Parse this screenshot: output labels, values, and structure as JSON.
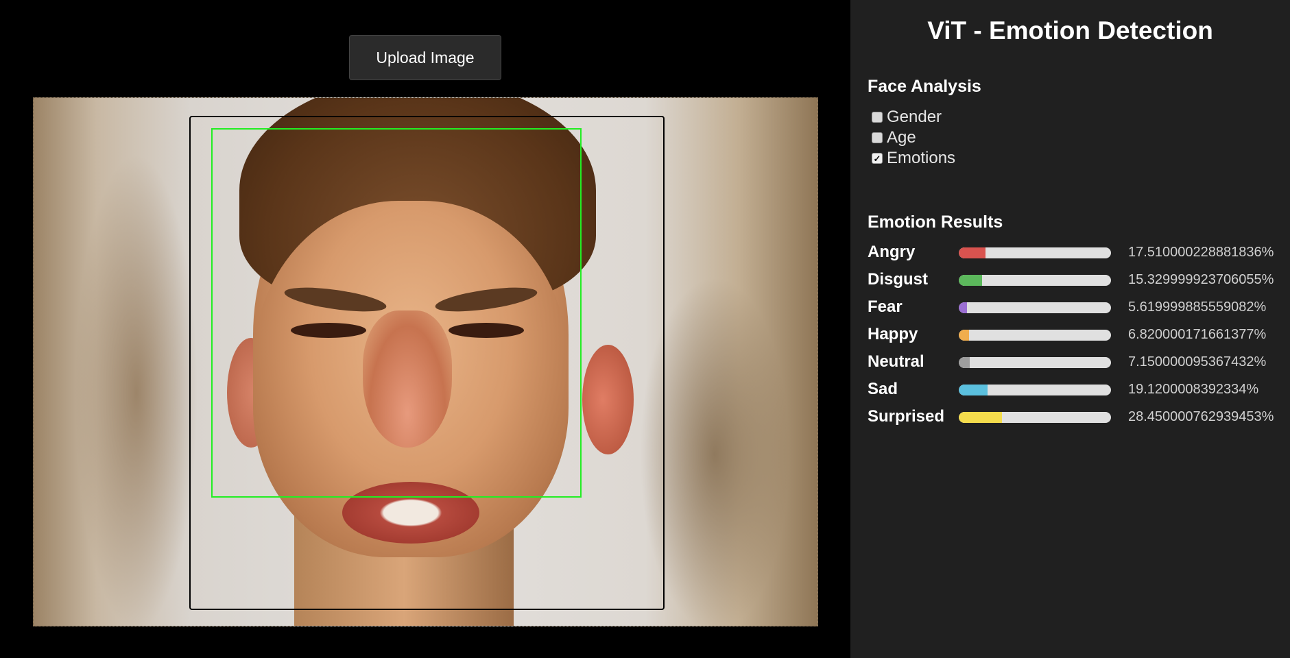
{
  "upload": {
    "label": "Upload Image"
  },
  "panel": {
    "title": "ViT - Emotion Detection",
    "face_analysis": {
      "heading": "Face Analysis",
      "options": [
        {
          "label": "Gender",
          "checked": false
        },
        {
          "label": "Age",
          "checked": false
        },
        {
          "label": "Emotions",
          "checked": true
        }
      ]
    },
    "emotion_results": {
      "heading": "Emotion Results",
      "items": [
        {
          "label": "Angry",
          "percent_text": "17.510000228881836%",
          "value": 17.51,
          "color": "#d9534f"
        },
        {
          "label": "Disgust",
          "percent_text": "15.329999923706055%",
          "value": 15.33,
          "color": "#5cb85c"
        },
        {
          "label": "Fear",
          "percent_text": "5.619999885559082%",
          "value": 5.62,
          "color": "#9b6fd3"
        },
        {
          "label": "Happy",
          "percent_text": "6.820000171661377%",
          "value": 6.82,
          "color": "#f0ad4e"
        },
        {
          "label": "Neutral",
          "percent_text": "7.150000095367432%",
          "value": 7.15,
          "color": "#9e9e9e"
        },
        {
          "label": "Sad",
          "percent_text": "19.1200008392334%",
          "value": 19.12,
          "color": "#5bc0de"
        },
        {
          "label": "Surprised",
          "percent_text": "28.450000762939453%",
          "value": 28.45,
          "color": "#f4dc4c"
        }
      ]
    }
  },
  "image_overlay": {
    "face_box_color": "#22ee22"
  }
}
